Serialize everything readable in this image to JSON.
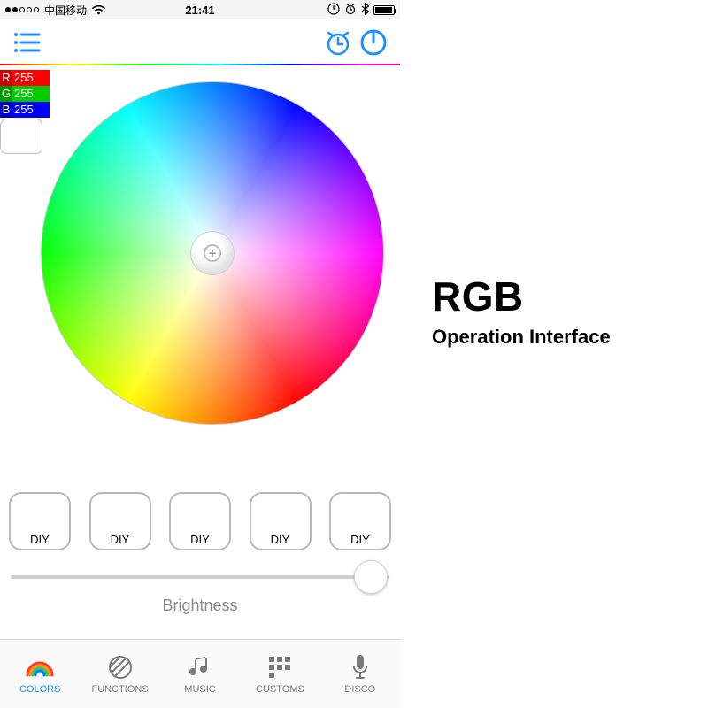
{
  "statusbar": {
    "carrier": "中国移动",
    "time": "21:41"
  },
  "rgb": {
    "r_label": "R",
    "r_value": "255",
    "g_label": "G",
    "g_value": "255",
    "b_label": "B",
    "b_value": "255"
  },
  "presets": {
    "items": [
      {
        "label": "DIY"
      },
      {
        "label": "DIY"
      },
      {
        "label": "DIY"
      },
      {
        "label": "DIY"
      },
      {
        "label": "DIY"
      }
    ]
  },
  "brightness": {
    "label": "Brightness",
    "percent": 95
  },
  "tabs": {
    "items": [
      {
        "label": "COLORS"
      },
      {
        "label": "FUNCTIONS"
      },
      {
        "label": "MUSIC"
      },
      {
        "label": "CUSTOMS"
      },
      {
        "label": "DISCO"
      }
    ],
    "active_index": 0
  },
  "caption": {
    "title": "RGB",
    "subtitle": "Operation Interface"
  }
}
